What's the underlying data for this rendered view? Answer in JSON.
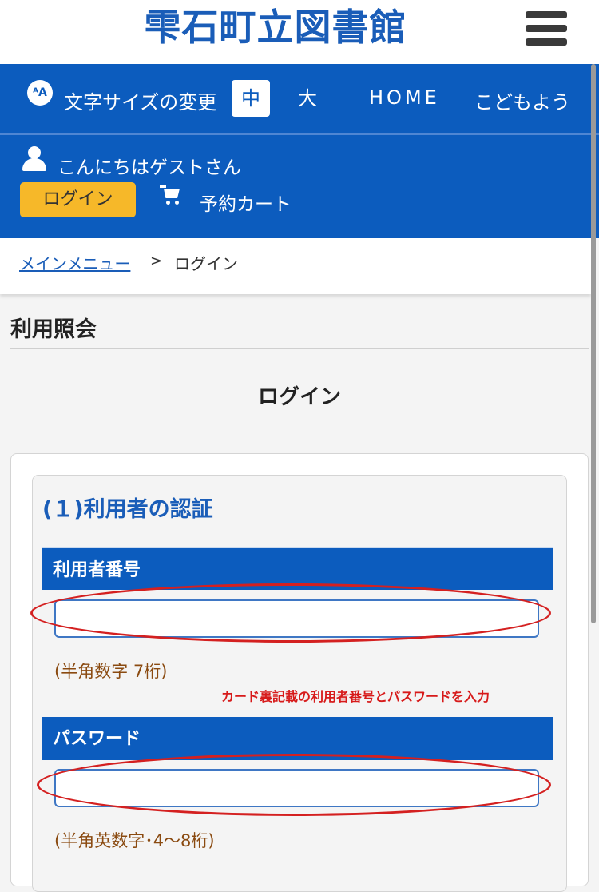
{
  "header": {
    "site_title": "雫石町立図書館",
    "menu_icon": "hamburger-menu-icon"
  },
  "nav": {
    "font_size_icon": "text-size-icon",
    "font_size_label": "文字サイズの変更",
    "size_medium": "中",
    "size_large": "大",
    "home": "HOME",
    "kids": "こどもよう"
  },
  "user": {
    "user_icon": "person-icon",
    "greeting": "こんにちはゲストさん",
    "login_button": "ログイン",
    "cart_icon": "cart-icon",
    "cart_label": "予約カート"
  },
  "breadcrumb": {
    "parent": "メインメニュー",
    "separator": ">",
    "current": "ログイン"
  },
  "page": {
    "section_title": "利用照会",
    "heading": "ログイン"
  },
  "auth": {
    "heading": "(１)利用者の認証",
    "user_number_label": "利用者番号",
    "user_number_value": "",
    "user_number_hint": "(半角数字 7桁)",
    "annotation": "カード裏記載の利用者番号とパスワードを入力",
    "password_label": "パスワード",
    "password_value": "",
    "password_hint": "(半角英数字･4～8桁)"
  },
  "colors": {
    "brand_blue": "#0c5cbe",
    "title_blue": "#1a5db8",
    "login_yellow": "#f6b829",
    "annotation_red": "#d71a1a"
  }
}
